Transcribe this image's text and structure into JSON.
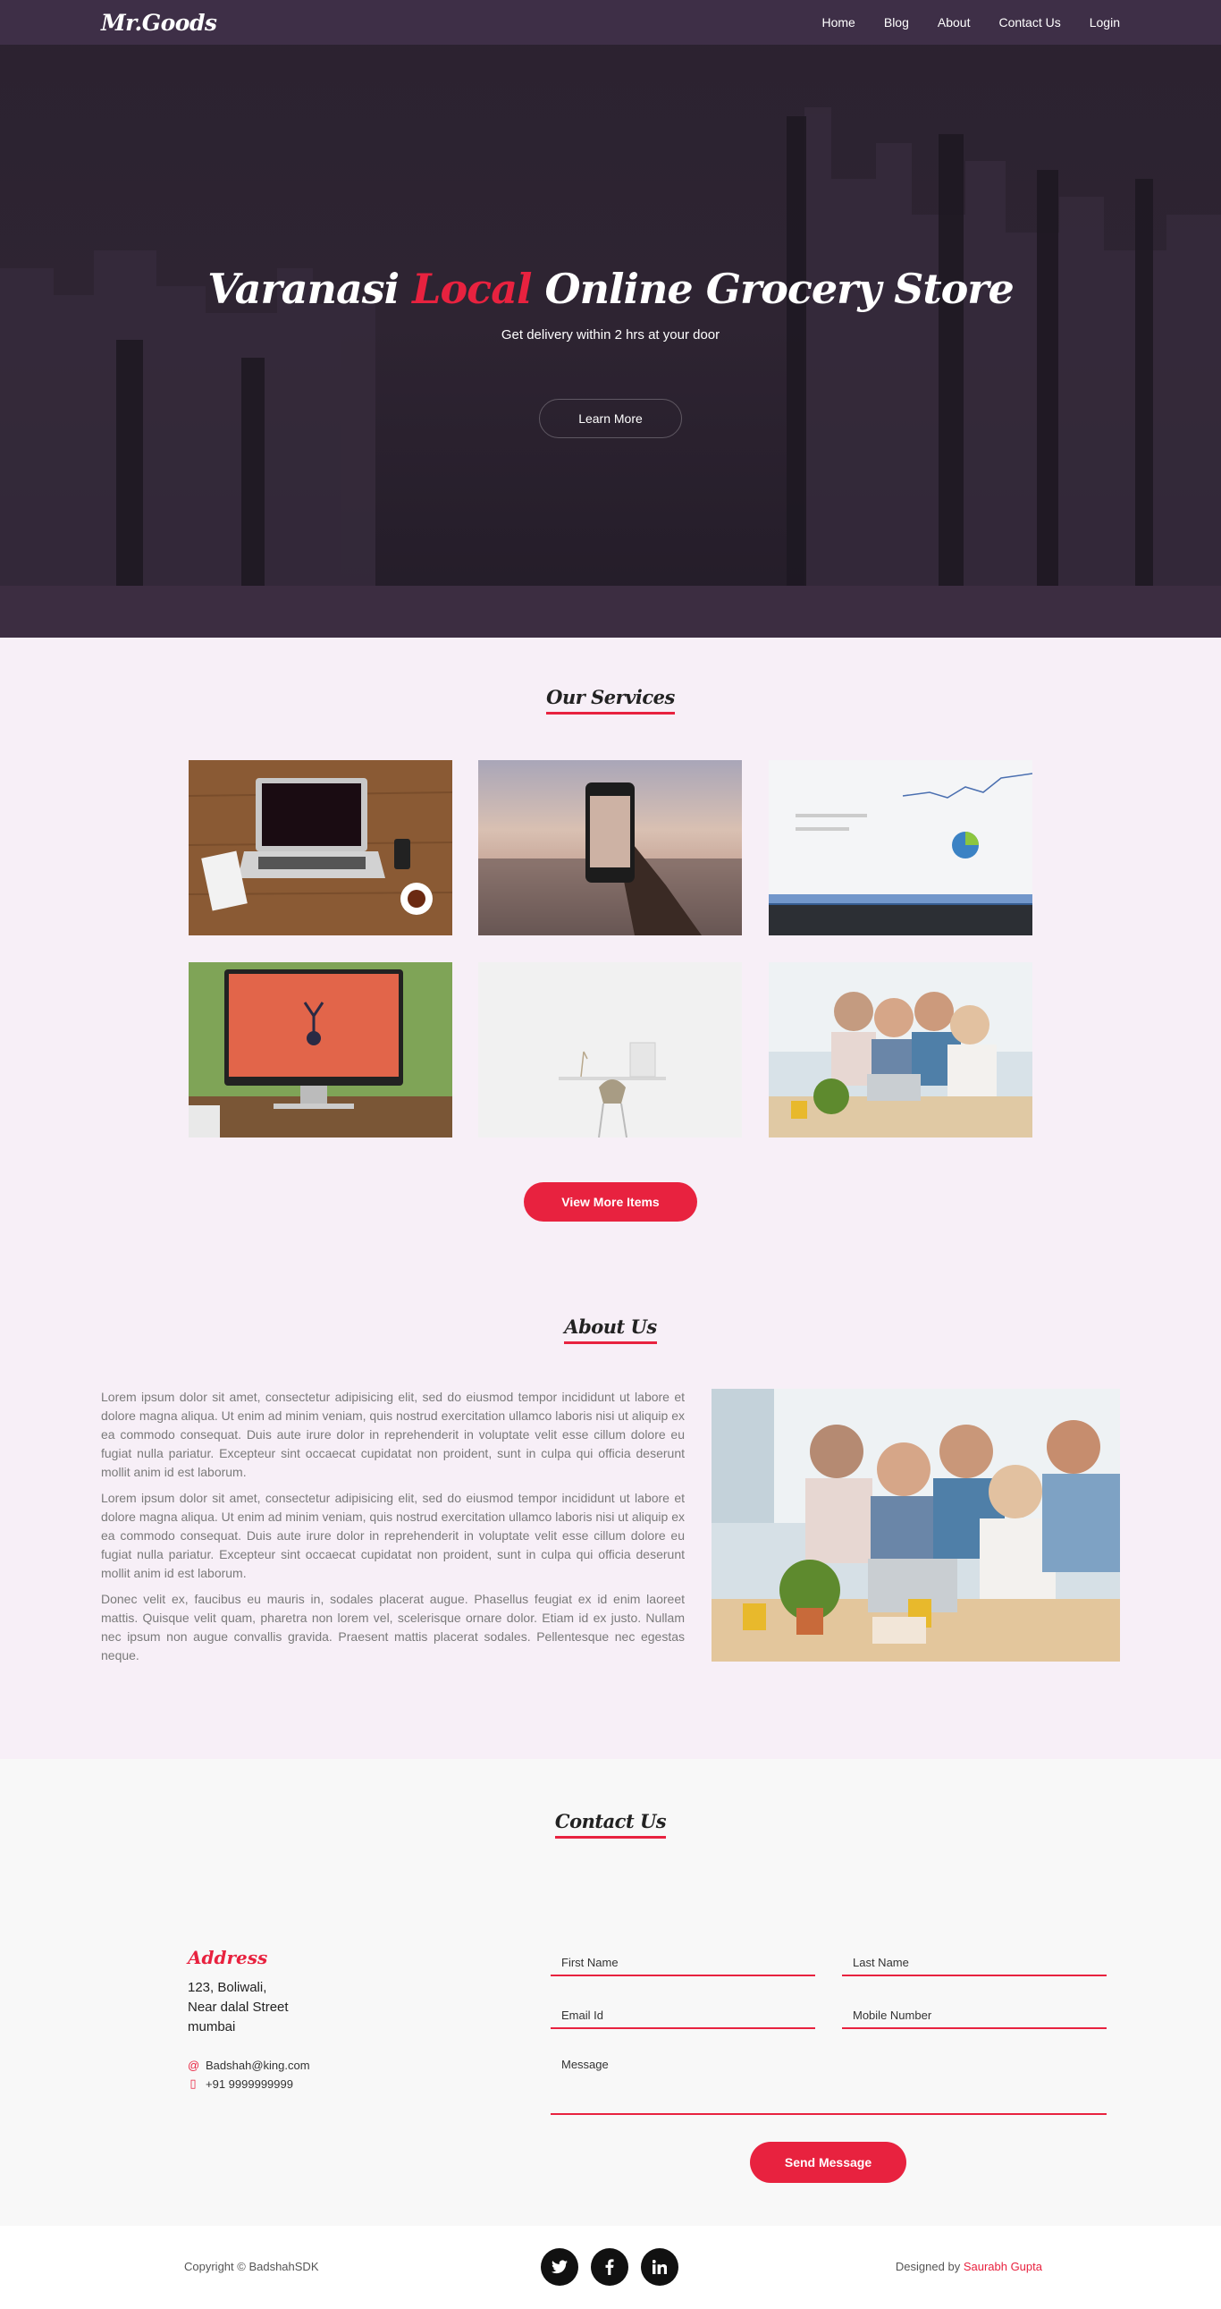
{
  "nav": {
    "brand": "Mr.Goods",
    "links": [
      "Home",
      "Blog",
      "About",
      "Contact Us",
      "Login"
    ]
  },
  "hero": {
    "title_part1": "Varanasi ",
    "title_accent": "Local",
    "title_part2": " Online Grocery Store",
    "subtitle": "Get delivery within 2 hrs at your door",
    "button": "Learn More"
  },
  "services": {
    "heading": "Our Services",
    "button": "View More Items"
  },
  "about": {
    "heading": "About Us",
    "paragraphs": [
      "Lorem ipsum dolor sit amet, consectetur adipisicing elit, sed do eiusmod tempor incididunt ut labore et dolore magna aliqua. Ut enim ad minim veniam, quis nostrud exercitation ullamco laboris nisi ut aliquip ex ea commodo consequat. Duis aute irure dolor in reprehenderit in voluptate velit esse cillum dolore eu fugiat nulla pariatur. Excepteur sint occaecat cupidatat non proident, sunt in culpa qui officia deserunt mollit anim id est laborum.",
      "Lorem ipsum dolor sit amet, consectetur adipisicing elit, sed do eiusmod tempor incididunt ut labore et dolore magna aliqua. Ut enim ad minim veniam, quis nostrud exercitation ullamco laboris nisi ut aliquip ex ea commodo consequat. Duis aute irure dolor in reprehenderit in voluptate velit esse cillum dolore eu fugiat nulla pariatur. Excepteur sint occaecat cupidatat non proident, sunt in culpa qui officia deserunt mollit anim id est laborum.",
      "Donec velit ex, faucibus eu mauris in, sodales placerat augue. Phasellus feugiat ex id enim laoreet mattis. Quisque velit quam, pharetra non lorem vel, scelerisque ornare dolor. Etiam id ex justo. Nullam nec ipsum non augue convallis gravida. Praesent mattis placerat sodales. Pellentesque nec egestas neque."
    ]
  },
  "contact": {
    "heading": "Contact Us",
    "address_title": "Address",
    "address_lines": [
      "123, Boliwali,",
      "Near dalal Street",
      "mumbai"
    ],
    "email": "Badshah@king.com",
    "phone": "+91 9999999999",
    "email_icon": "at-icon",
    "phone_icon": "mobile-icon",
    "placeholders": {
      "first_name": "First Name",
      "last_name": "Last Name",
      "email": "Email Id",
      "mobile": "Mobile Number",
      "message": "Message"
    },
    "send_button": "Send Message"
  },
  "footer": {
    "copyright": "Copyright © BadshahSDK",
    "designed_by": "Designed by ",
    "author": "Saurabh Gupta",
    "socials": [
      "twitter-icon",
      "facebook-icon",
      "linkedin-icon"
    ]
  },
  "colors": {
    "accent": "#e8223f",
    "navbar": "#3e2f47",
    "hero_overlay": "#2a2130",
    "section_bg": "#f7eff7"
  }
}
